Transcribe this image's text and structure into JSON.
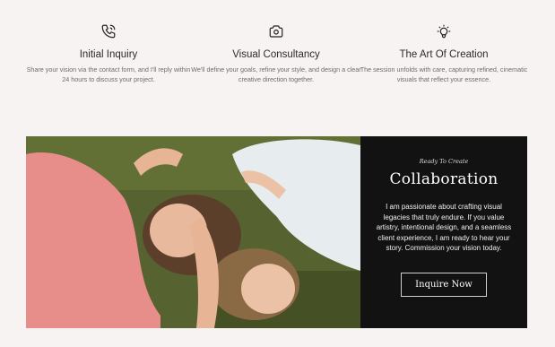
{
  "steps": [
    {
      "icon": "phone-call-icon",
      "title": "Initial Inquiry",
      "description": "Share your vision via the contact form, and I'll reply within 24 hours to discuss your project."
    },
    {
      "icon": "camera-icon",
      "title": "Visual Consultancy",
      "description": "We'll define your goals, refine your style, and design a clear creative direction together."
    },
    {
      "icon": "lightbulb-icon",
      "title": "The Art Of Creation",
      "description": "The session unfolds with care, capturing refined, cinematic visuals that reflect your essence."
    }
  ],
  "feature": {
    "kicker": "Ready To Create",
    "heading": "Collaboration",
    "body": "I am passionate about crafting visual legacies that truly endure. If you value artistry, intentional design, and a seamless client experience, I am ready to hear your story. Commission your vision today.",
    "cta_label": "Inquire Now"
  },
  "colors": {
    "page_background": "#f7f3f2",
    "panel_background": "#121212",
    "text_dark": "#2b2b2b",
    "text_muted": "#6d6d6d"
  }
}
